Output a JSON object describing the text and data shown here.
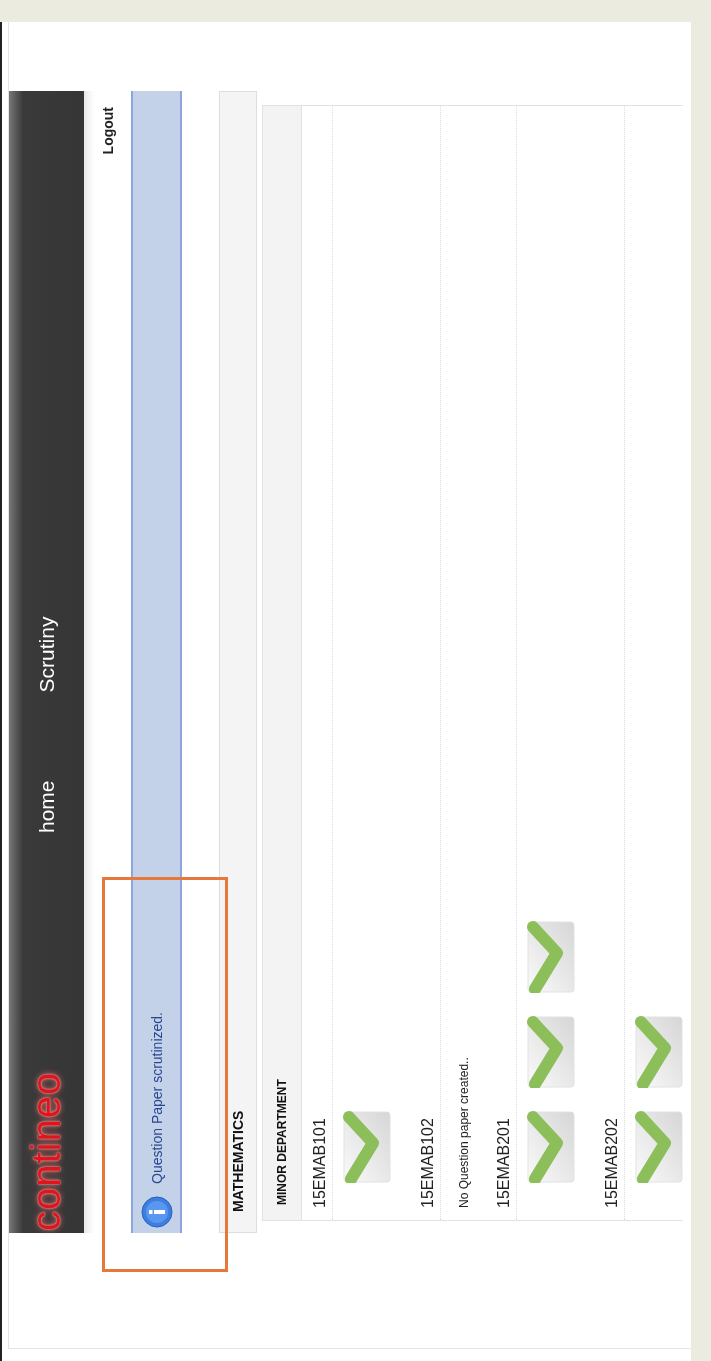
{
  "header": {
    "logo": "contineo",
    "nav": [
      {
        "label": "home"
      },
      {
        "label": "Scrutiny"
      }
    ],
    "logout": "Logout"
  },
  "notice": {
    "message": "Question Paper scrutinized.",
    "highlighted": true
  },
  "department": "MATHEMATICS",
  "panel": {
    "title": "MINOR DEPARTMENT",
    "courses": [
      {
        "code": "15EMAB101",
        "papers": [
          {
            "kind": "document"
          }
        ]
      },
      {
        "code": "15EMAB102",
        "message": "No Question paper created.."
      },
      {
        "code": "15EMAB201",
        "papers": [
          {
            "kind": "document"
          },
          {
            "kind": "document"
          },
          {
            "kind": "document"
          }
        ]
      },
      {
        "code": "15EMAB202",
        "papers": [
          {
            "kind": "document"
          },
          {
            "kind": "document"
          }
        ]
      }
    ]
  }
}
